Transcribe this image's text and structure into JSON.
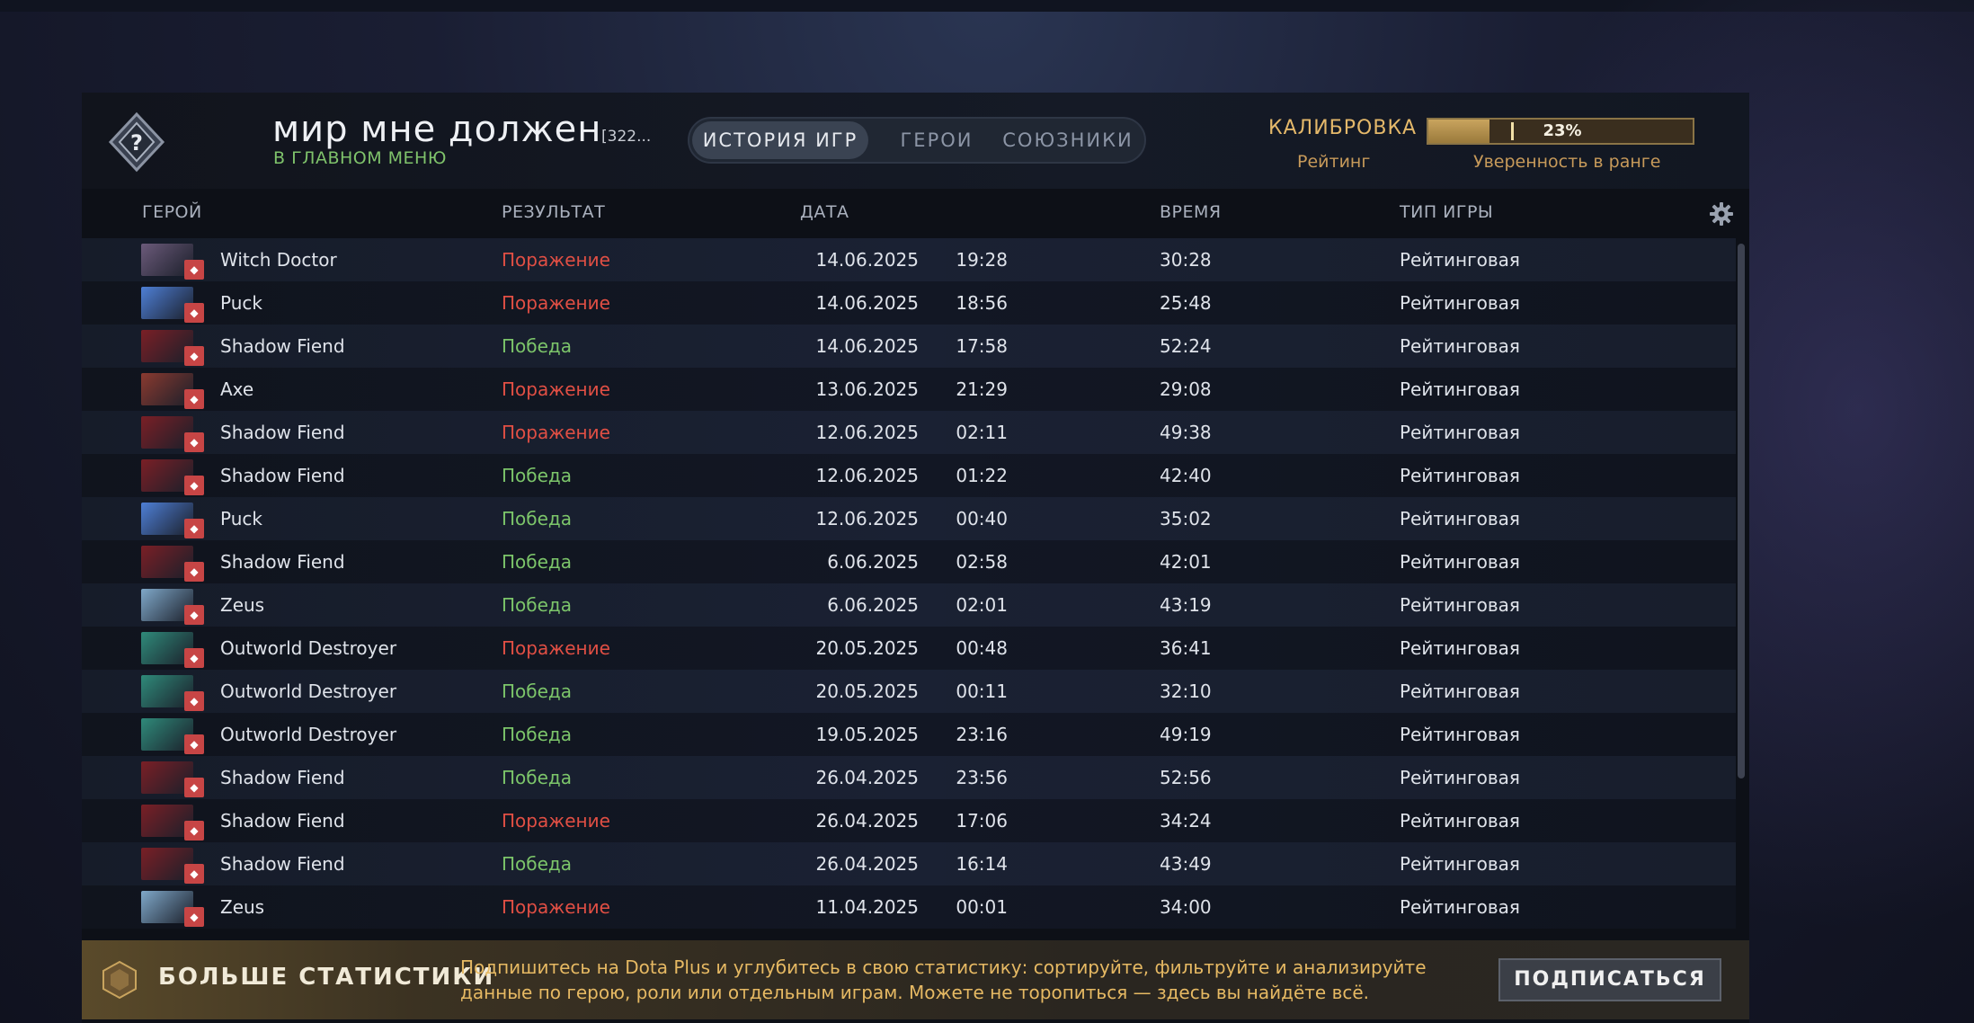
{
  "header": {
    "player_name": "мир мне должен",
    "player_id": "[322...",
    "status": "В ГЛАВНОМ МЕНЮ",
    "tabs": [
      {
        "label": "ИСТОРИЯ ИГР",
        "active": true
      },
      {
        "label": "ГЕРОИ",
        "active": false
      },
      {
        "label": "СОЮЗНИКИ",
        "active": false
      }
    ],
    "calibration_label": "КАЛИБРОВКА",
    "rating_label": "Рейтинг",
    "confidence_value": "23%",
    "confidence_fraction": 0.23,
    "confidence_label": "Уверенность в ранге"
  },
  "columns": {
    "hero": "ГЕРОЙ",
    "result": "РЕЗУЛЬТАТ",
    "date": "ДАТА",
    "time": "ВРЕМЯ",
    "game_type": "ТИП ИГРЫ"
  },
  "matches": [
    {
      "hero": "Witch Doctor",
      "result": "Поражение",
      "win": false,
      "date": "14.06.2025",
      "start": "19:28",
      "duration": "30:28",
      "type": "Рейтинговая",
      "color": "#6b5a7a"
    },
    {
      "hero": "Puck",
      "result": "Поражение",
      "win": false,
      "date": "14.06.2025",
      "start": "18:56",
      "duration": "25:48",
      "type": "Рейтинговая",
      "color": "#4e7fd6"
    },
    {
      "hero": "Shadow Fiend",
      "result": "Победа",
      "win": true,
      "date": "14.06.2025",
      "start": "17:58",
      "duration": "52:24",
      "type": "Рейтинговая",
      "color": "#7a1f26"
    },
    {
      "hero": "Axe",
      "result": "Поражение",
      "win": false,
      "date": "13.06.2025",
      "start": "21:29",
      "duration": "29:08",
      "type": "Рейтинговая",
      "color": "#8a3a30"
    },
    {
      "hero": "Shadow Fiend",
      "result": "Поражение",
      "win": false,
      "date": "12.06.2025",
      "start": "02:11",
      "duration": "49:38",
      "type": "Рейтинговая",
      "color": "#7a1f26"
    },
    {
      "hero": "Shadow Fiend",
      "result": "Победа",
      "win": true,
      "date": "12.06.2025",
      "start": "01:22",
      "duration": "42:40",
      "type": "Рейтинговая",
      "color": "#7a1f26"
    },
    {
      "hero": "Puck",
      "result": "Победа",
      "win": true,
      "date": "12.06.2025",
      "start": "00:40",
      "duration": "35:02",
      "type": "Рейтинговая",
      "color": "#4e7fd6"
    },
    {
      "hero": "Shadow Fiend",
      "result": "Победа",
      "win": true,
      "date": "6.06.2025",
      "start": "02:58",
      "duration": "42:01",
      "type": "Рейтинговая",
      "color": "#7a1f26"
    },
    {
      "hero": "Zeus",
      "result": "Победа",
      "win": true,
      "date": "6.06.2025",
      "start": "02:01",
      "duration": "43:19",
      "type": "Рейтинговая",
      "color": "#7fa8c9"
    },
    {
      "hero": "Outworld Destroyer",
      "result": "Поражение",
      "win": false,
      "date": "20.05.2025",
      "start": "00:48",
      "duration": "36:41",
      "type": "Рейтинговая",
      "color": "#2f8a7a"
    },
    {
      "hero": "Outworld Destroyer",
      "result": "Победа",
      "win": true,
      "date": "20.05.2025",
      "start": "00:11",
      "duration": "32:10",
      "type": "Рейтинговая",
      "color": "#2f8a7a"
    },
    {
      "hero": "Outworld Destroyer",
      "result": "Победа",
      "win": true,
      "date": "19.05.2025",
      "start": "23:16",
      "duration": "49:19",
      "type": "Рейтинговая",
      "color": "#2f8a7a"
    },
    {
      "hero": "Shadow Fiend",
      "result": "Победа",
      "win": true,
      "date": "26.04.2025",
      "start": "23:56",
      "duration": "52:56",
      "type": "Рейтинговая",
      "color": "#7a1f26"
    },
    {
      "hero": "Shadow Fiend",
      "result": "Поражение",
      "win": false,
      "date": "26.04.2025",
      "start": "17:06",
      "duration": "34:24",
      "type": "Рейтинговая",
      "color": "#7a1f26"
    },
    {
      "hero": "Shadow Fiend",
      "result": "Победа",
      "win": true,
      "date": "26.04.2025",
      "start": "16:14",
      "duration": "43:49",
      "type": "Рейтинговая",
      "color": "#7a1f26"
    },
    {
      "hero": "Zeus",
      "result": "Поражение",
      "win": false,
      "date": "11.04.2025",
      "start": "00:01",
      "duration": "34:00",
      "type": "Рейтинговая",
      "color": "#7fa8c9"
    }
  ],
  "footer": {
    "title": "БОЛЬШЕ СТАТИСТИКИ",
    "text": "Подпишитесь на Dota Plus и углубитесь в свою статистику: сортируйте, фильтруйте и анализируйте данные по герою, роли или отдельным играм. Можете не торопиться — здесь вы найдёте всё.",
    "button": "ПОДПИСАТЬСЯ"
  },
  "icons": {
    "rank": "rank-uncalibrated-icon",
    "settings": "gear-icon",
    "dota_plus": "dota-plus-icon"
  }
}
